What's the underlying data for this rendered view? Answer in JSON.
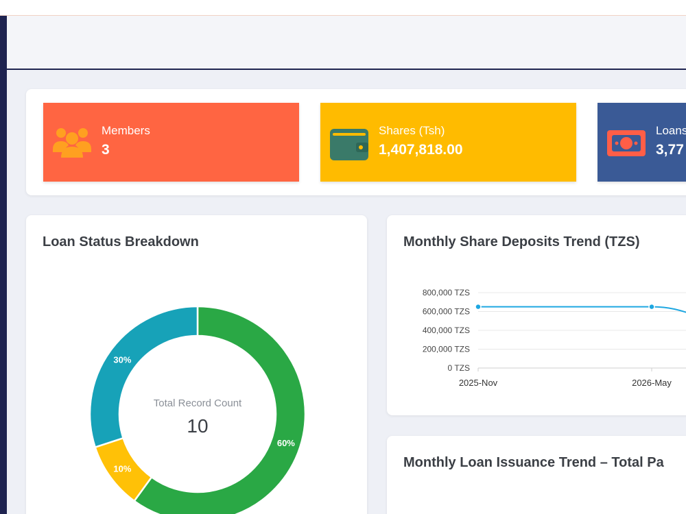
{
  "stats": [
    {
      "label": "Members",
      "value": "3",
      "color": "#ff6542",
      "icon": "users-icon"
    },
    {
      "label": "Shares (Tsh)",
      "value": "1,407,818.00",
      "color": "#ffbb00",
      "icon": "wallet-icon"
    },
    {
      "label": "Loans",
      "value": "3,77",
      "color": "#3a5a96",
      "icon": "money-bill-icon"
    }
  ],
  "loan_status": {
    "title": "Loan Status Breakdown",
    "center_label": "Total Record Count",
    "center_value": "10"
  },
  "share_trend": {
    "title": "Monthly Share Deposits Trend (TZS)"
  },
  "loan_trend": {
    "title": "Monthly Loan Issuance Trend – Total Pa"
  },
  "chart_data": [
    {
      "type": "pie",
      "title": "Loan Status Breakdown",
      "labels": [
        "60%",
        "10%",
        "30%"
      ],
      "values": [
        60,
        10,
        30
      ],
      "colors": [
        "#2aa845",
        "#ffc107",
        "#17a2b8"
      ],
      "donut": true
    },
    {
      "type": "line",
      "title": "Monthly Share Deposits Trend (TZS)",
      "x": [
        "2025-Nov",
        "2026-May"
      ],
      "y_ticks": [
        "800,000 TZS",
        "600,000 TZS",
        "400,000 TZS",
        "200,000 TZS",
        "0 TZS"
      ],
      "ylim": [
        0,
        800000
      ],
      "series": [
        {
          "values": [
            650000,
            650000
          ],
          "color": "#1ea7e1"
        }
      ],
      "grid": true
    }
  ]
}
